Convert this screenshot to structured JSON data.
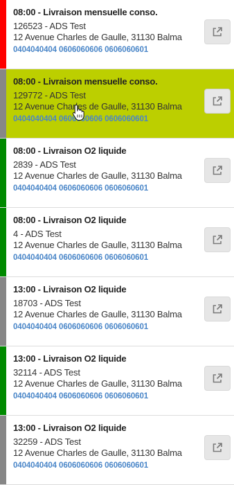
{
  "colors": {
    "red": "#ff0000",
    "gray": "#878787",
    "green": "#008a00",
    "selected_bg": "#bccf00",
    "phone_link": "#4a86c8"
  },
  "deliveries": [
    {
      "time_title": "08:00 - Livraison mensuelle conso.",
      "client": "126523 - ADS Test",
      "address": "12 Avenue Charles de Gaulle, 31130 Balma",
      "phones": "0404040404 0606060606 0606060601",
      "status_color": "red",
      "selected": false
    },
    {
      "time_title": "08:00 - Livraison mensuelle conso.",
      "client": "129772 - ADS Test",
      "address": "12 Avenue Charles de Gaulle, 31130 Balma",
      "phones": "0404040404 0606060606 0606060601",
      "status_color": "gray",
      "selected": true
    },
    {
      "time_title": "08:00 - Livraison O2 liquide",
      "client": "2839 - ADS Test",
      "address": "12 Avenue Charles de Gaulle, 31130 Balma",
      "phones": "0404040404 0606060606 0606060601",
      "status_color": "green",
      "selected": false
    },
    {
      "time_title": "08:00 - Livraison O2 liquide",
      "client": "4 - ADS Test",
      "address": "12 Avenue Charles de Gaulle, 31130 Balma",
      "phones": "0404040404 0606060606 0606060601",
      "status_color": "green",
      "selected": false
    },
    {
      "time_title": "13:00 - Livraison O2 liquide",
      "client": "18703 - ADS Test",
      "address": "12 Avenue Charles de Gaulle, 31130 Balma",
      "phones": "0404040404 0606060606 0606060601",
      "status_color": "gray",
      "selected": false
    },
    {
      "time_title": "13:00 - Livraison O2 liquide",
      "client": "32114 - ADS Test",
      "address": "12 Avenue Charles de Gaulle, 31130 Balma",
      "phones": "0404040404 0606060606 0606060601",
      "status_color": "green",
      "selected": false
    },
    {
      "time_title": "13:00 - Livraison O2 liquide",
      "client": "32259 - ADS Test",
      "address": "12 Avenue Charles de Gaulle, 31130 Balma",
      "phones": "0404040404 0606060606 0606060601",
      "status_color": "gray",
      "selected": false
    }
  ],
  "icons": {
    "open_button": "external-link-icon",
    "cursor": "hand-pointer-icon"
  }
}
